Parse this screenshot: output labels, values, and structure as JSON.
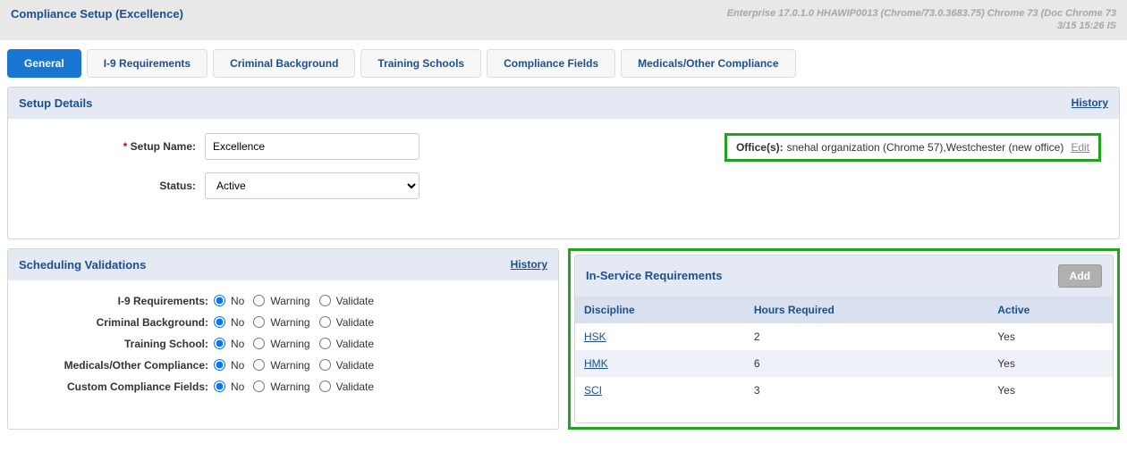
{
  "header": {
    "title": "Compliance Setup (Excellence)",
    "env_line1": "Enterprise 17.0.1.0 HHAWIP0013 (Chrome/73.0.3683.75) Chrome 73 (Doc Chrome 73",
    "env_line2": "3/15 15:26 IS"
  },
  "tabs": [
    {
      "label": "General",
      "active": true
    },
    {
      "label": "I-9 Requirements",
      "active": false
    },
    {
      "label": "Criminal Background",
      "active": false
    },
    {
      "label": "Training Schools",
      "active": false
    },
    {
      "label": "Compliance Fields",
      "active": false
    },
    {
      "label": "Medicals/Other Compliance",
      "active": false
    }
  ],
  "setup": {
    "panel_title": "Setup Details",
    "history_label": "History",
    "name_label": "Setup Name:",
    "name_value": "Excellence",
    "status_label": "Status:",
    "status_value": "Active",
    "office_label": "Office(s):",
    "office_value": "snehal organization (Chrome 57),Westchester (new office)",
    "edit_label": "Edit"
  },
  "scheduling": {
    "panel_title": "Scheduling Validations",
    "history_label": "History",
    "options": {
      "no": "No",
      "warning": "Warning",
      "validate": "Validate"
    },
    "rows": [
      {
        "label": "I-9 Requirements:",
        "selected": "no"
      },
      {
        "label": "Criminal Background:",
        "selected": "no"
      },
      {
        "label": "Training School:",
        "selected": "no"
      },
      {
        "label": "Medicals/Other Compliance:",
        "selected": "no"
      },
      {
        "label": "Custom Compliance Fields:",
        "selected": "no"
      }
    ]
  },
  "inservice": {
    "panel_title": "In-Service Requirements",
    "add_label": "Add",
    "columns": [
      "Discipline",
      "Hours Required",
      "Active"
    ],
    "rows": [
      {
        "discipline": "HSK",
        "hours": "2",
        "active": "Yes"
      },
      {
        "discipline": "HMK",
        "hours": "6",
        "active": "Yes"
      },
      {
        "discipline": "SCI",
        "hours": "3",
        "active": "Yes"
      }
    ]
  }
}
